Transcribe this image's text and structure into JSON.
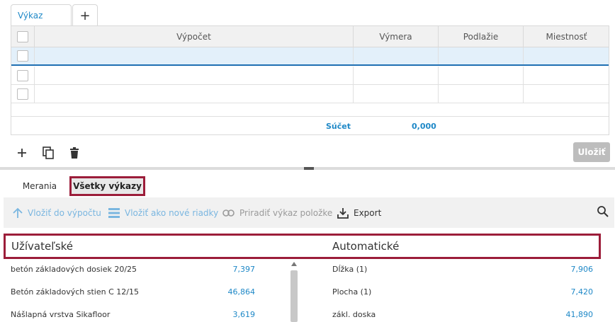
{
  "tabs": {
    "active_label": "Výkaz",
    "add_label": "+"
  },
  "grid": {
    "columns": [
      "Výpočet",
      "Výmera",
      "Podlažie",
      "Miestnosť"
    ],
    "sum_label": "Súčet",
    "sum_value": "0,000"
  },
  "toolbar": {
    "save_label": "Uložiť"
  },
  "subtabs": {
    "measurements": "Merania",
    "all_reports": "Všetky výkazy"
  },
  "actions": {
    "insert_into_calc": "Vložiť do výpočtu",
    "insert_as_rows": "Vložiť ako nové riadky",
    "assign_to_item": "Priradiť výkaz položke",
    "export": "Export"
  },
  "lists": {
    "user_title": "Užívateľské",
    "auto_title": "Automatické",
    "user_items": [
      {
        "name": "betón základových dosiek 20/25",
        "value": "7,397"
      },
      {
        "name": "Betón základových stien C 12/15",
        "value": "46,864"
      },
      {
        "name": "Nášlapná vrstva Sikafloor",
        "value": "3,619"
      }
    ],
    "auto_items": [
      {
        "name": "Dĺžka (1)",
        "value": "7,906"
      },
      {
        "name": "Plocha (1)",
        "value": "7,420"
      },
      {
        "name": "zákl. doska",
        "value": "41,890"
      }
    ]
  },
  "colors": {
    "accent": "#1e88c7",
    "highlight": "#9c1d3a",
    "selected_row": "#e3f0fa"
  }
}
